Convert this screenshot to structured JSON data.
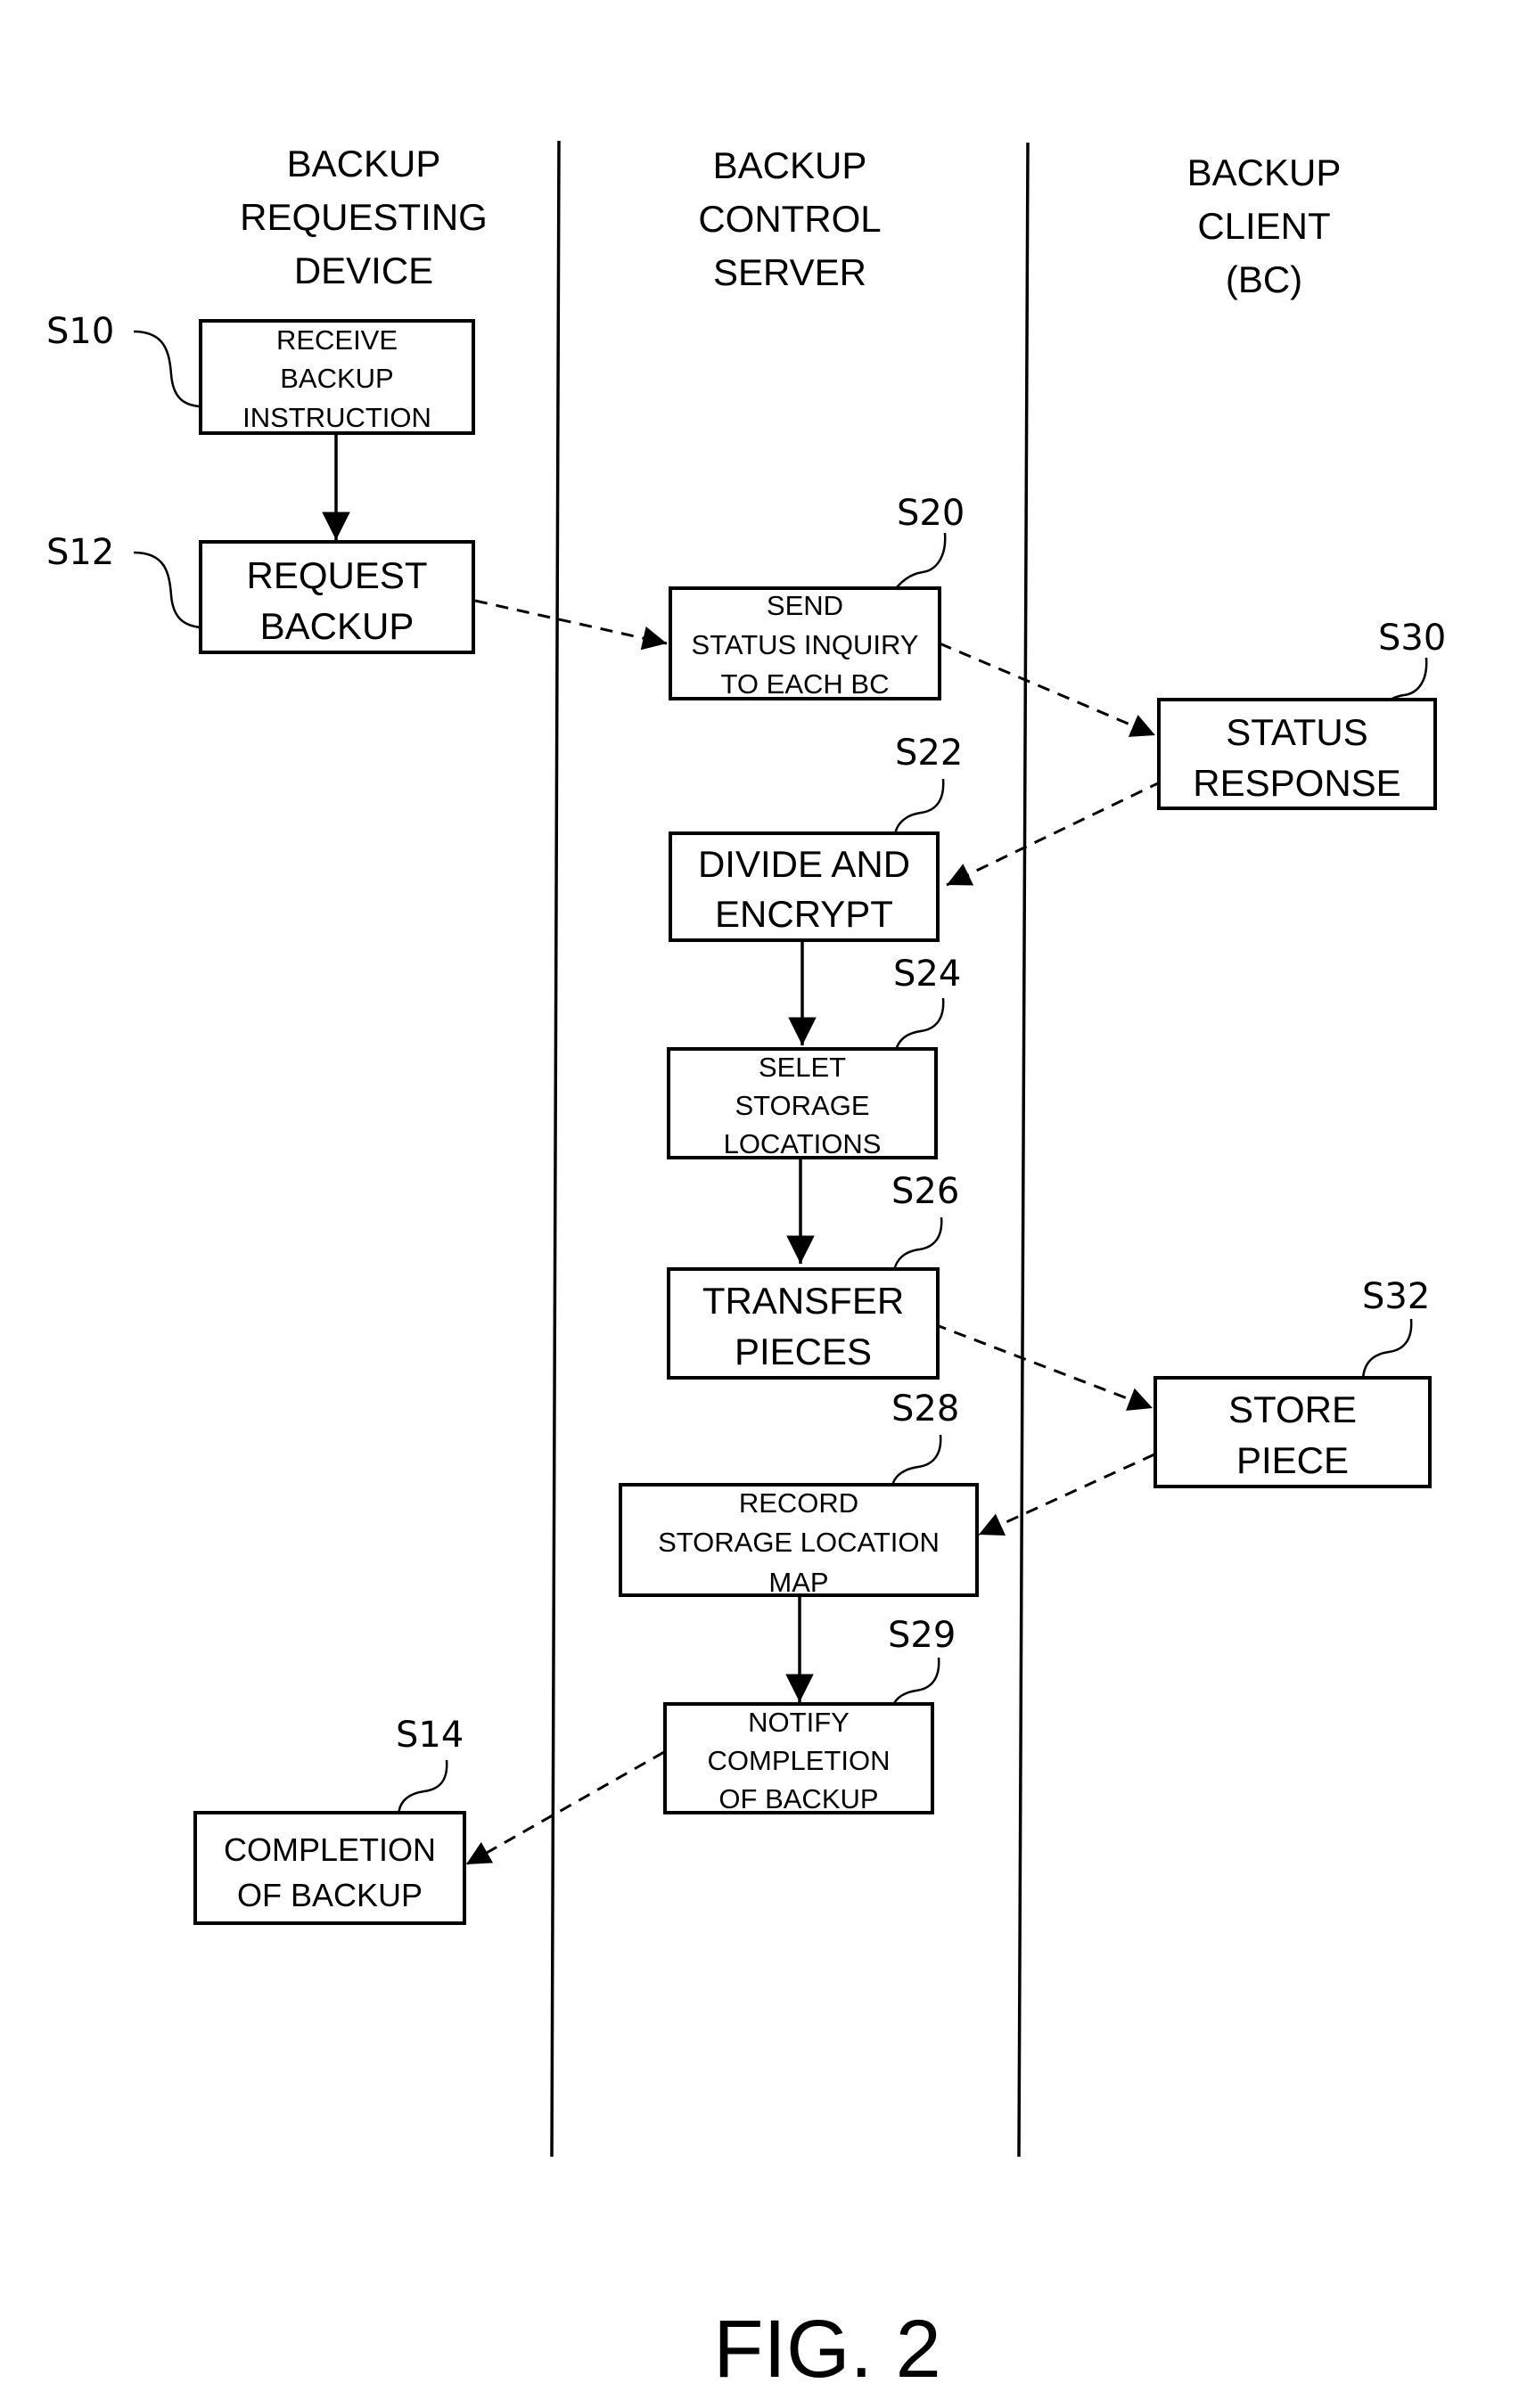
{
  "figure_label": "FIG. 2",
  "lanes": [
    {
      "id": "requesting-device",
      "title_lines": [
        "BACKUP",
        "REQUESTING",
        "DEVICE"
      ]
    },
    {
      "id": "control-server",
      "title_lines": [
        "BACKUP",
        "CONTROL",
        "SERVER"
      ]
    },
    {
      "id": "backup-client",
      "title_lines": [
        "BACKUP",
        "CLIENT",
        "(BC)"
      ]
    }
  ],
  "steps": {
    "S10": {
      "label": "S10",
      "lines": [
        "RECEIVE",
        "BACKUP",
        "INSTRUCTION"
      ],
      "lane": "requesting-device"
    },
    "S12": {
      "label": "S12",
      "lines": [
        "REQUEST",
        "BACKUP"
      ],
      "lane": "requesting-device"
    },
    "S14": {
      "label": "S14",
      "lines": [
        "COMPLETION",
        "OF BACKUP"
      ],
      "lane": "requesting-device"
    },
    "S20": {
      "label": "S20",
      "lines": [
        "SEND",
        "STATUS INQUIRY",
        "TO EACH BC"
      ],
      "lane": "control-server"
    },
    "S22": {
      "label": "S22",
      "lines": [
        "DIVIDE AND",
        "ENCRYPT"
      ],
      "lane": "control-server"
    },
    "S24": {
      "label": "S24",
      "lines": [
        "SELET",
        "STORAGE",
        "LOCATIONS"
      ],
      "lane": "control-server"
    },
    "S26": {
      "label": "S26",
      "lines": [
        "TRANSFER",
        "PIECES"
      ],
      "lane": "control-server"
    },
    "S28": {
      "label": "S28",
      "lines": [
        "RECORD",
        "STORAGE LOCATION",
        "MAP"
      ],
      "lane": "control-server"
    },
    "S29": {
      "label": "S29",
      "lines": [
        "NOTIFY",
        "COMPLETION",
        "OF BACKUP"
      ],
      "lane": "control-server"
    },
    "S30": {
      "label": "S30",
      "lines": [
        "STATUS",
        "RESPONSE"
      ],
      "lane": "backup-client"
    },
    "S32": {
      "label": "S32",
      "lines": [
        "STORE",
        "PIECE"
      ],
      "lane": "backup-client"
    }
  },
  "flows": [
    {
      "from": "S10",
      "to": "S12",
      "style": "solid"
    },
    {
      "from": "S12",
      "to": "S20",
      "style": "dashed"
    },
    {
      "from": "S20",
      "to": "S30",
      "style": "dashed"
    },
    {
      "from": "S30",
      "to": "S22",
      "style": "dashed"
    },
    {
      "from": "S22",
      "to": "S24",
      "style": "solid"
    },
    {
      "from": "S24",
      "to": "S26",
      "style": "solid"
    },
    {
      "from": "S26",
      "to": "S32",
      "style": "dashed"
    },
    {
      "from": "S32",
      "to": "S28",
      "style": "dashed"
    },
    {
      "from": "S28",
      "to": "S29",
      "style": "solid"
    },
    {
      "from": "S29",
      "to": "S14",
      "style": "dashed"
    }
  ]
}
